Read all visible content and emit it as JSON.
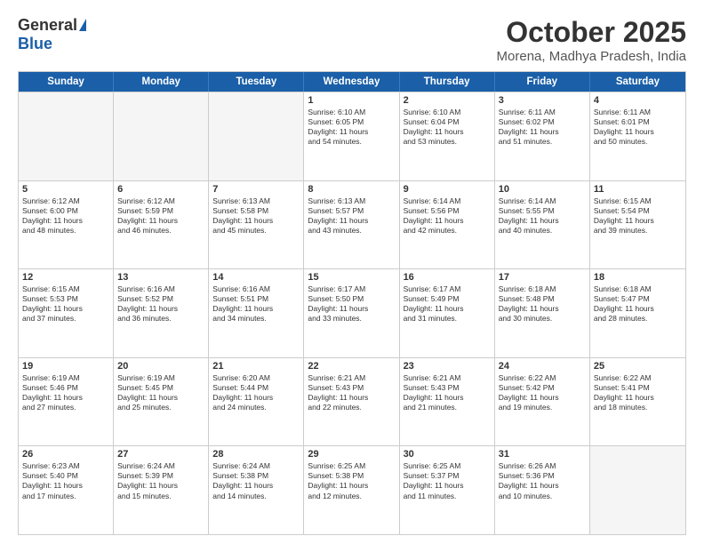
{
  "header": {
    "logo_general": "General",
    "logo_blue": "Blue",
    "main_title": "October 2025",
    "subtitle": "Morena, Madhya Pradesh, India"
  },
  "calendar": {
    "days_of_week": [
      "Sunday",
      "Monday",
      "Tuesday",
      "Wednesday",
      "Thursday",
      "Friday",
      "Saturday"
    ],
    "weeks": [
      [
        {
          "day": "",
          "sunrise": "",
          "sunset": "",
          "daylight": "",
          "empty": true
        },
        {
          "day": "",
          "sunrise": "",
          "sunset": "",
          "daylight": "",
          "empty": true
        },
        {
          "day": "",
          "sunrise": "",
          "sunset": "",
          "daylight": "",
          "empty": true
        },
        {
          "day": "1",
          "sunrise": "Sunrise: 6:10 AM",
          "sunset": "Sunset: 6:05 PM",
          "daylight": "Daylight: 11 hours and 54 minutes."
        },
        {
          "day": "2",
          "sunrise": "Sunrise: 6:10 AM",
          "sunset": "Sunset: 6:04 PM",
          "daylight": "Daylight: 11 hours and 53 minutes."
        },
        {
          "day": "3",
          "sunrise": "Sunrise: 6:11 AM",
          "sunset": "Sunset: 6:02 PM",
          "daylight": "Daylight: 11 hours and 51 minutes."
        },
        {
          "day": "4",
          "sunrise": "Sunrise: 6:11 AM",
          "sunset": "Sunset: 6:01 PM",
          "daylight": "Daylight: 11 hours and 50 minutes."
        }
      ],
      [
        {
          "day": "5",
          "sunrise": "Sunrise: 6:12 AM",
          "sunset": "Sunset: 6:00 PM",
          "daylight": "Daylight: 11 hours and 48 minutes."
        },
        {
          "day": "6",
          "sunrise": "Sunrise: 6:12 AM",
          "sunset": "Sunset: 5:59 PM",
          "daylight": "Daylight: 11 hours and 46 minutes."
        },
        {
          "day": "7",
          "sunrise": "Sunrise: 6:13 AM",
          "sunset": "Sunset: 5:58 PM",
          "daylight": "Daylight: 11 hours and 45 minutes."
        },
        {
          "day": "8",
          "sunrise": "Sunrise: 6:13 AM",
          "sunset": "Sunset: 5:57 PM",
          "daylight": "Daylight: 11 hours and 43 minutes."
        },
        {
          "day": "9",
          "sunrise": "Sunrise: 6:14 AM",
          "sunset": "Sunset: 5:56 PM",
          "daylight": "Daylight: 11 hours and 42 minutes."
        },
        {
          "day": "10",
          "sunrise": "Sunrise: 6:14 AM",
          "sunset": "Sunset: 5:55 PM",
          "daylight": "Daylight: 11 hours and 40 minutes."
        },
        {
          "day": "11",
          "sunrise": "Sunrise: 6:15 AM",
          "sunset": "Sunset: 5:54 PM",
          "daylight": "Daylight: 11 hours and 39 minutes."
        }
      ],
      [
        {
          "day": "12",
          "sunrise": "Sunrise: 6:15 AM",
          "sunset": "Sunset: 5:53 PM",
          "daylight": "Daylight: 11 hours and 37 minutes."
        },
        {
          "day": "13",
          "sunrise": "Sunrise: 6:16 AM",
          "sunset": "Sunset: 5:52 PM",
          "daylight": "Daylight: 11 hours and 36 minutes."
        },
        {
          "day": "14",
          "sunrise": "Sunrise: 6:16 AM",
          "sunset": "Sunset: 5:51 PM",
          "daylight": "Daylight: 11 hours and 34 minutes."
        },
        {
          "day": "15",
          "sunrise": "Sunrise: 6:17 AM",
          "sunset": "Sunset: 5:50 PM",
          "daylight": "Daylight: 11 hours and 33 minutes."
        },
        {
          "day": "16",
          "sunrise": "Sunrise: 6:17 AM",
          "sunset": "Sunset: 5:49 PM",
          "daylight": "Daylight: 11 hours and 31 minutes."
        },
        {
          "day": "17",
          "sunrise": "Sunrise: 6:18 AM",
          "sunset": "Sunset: 5:48 PM",
          "daylight": "Daylight: 11 hours and 30 minutes."
        },
        {
          "day": "18",
          "sunrise": "Sunrise: 6:18 AM",
          "sunset": "Sunset: 5:47 PM",
          "daylight": "Daylight: 11 hours and 28 minutes."
        }
      ],
      [
        {
          "day": "19",
          "sunrise": "Sunrise: 6:19 AM",
          "sunset": "Sunset: 5:46 PM",
          "daylight": "Daylight: 11 hours and 27 minutes."
        },
        {
          "day": "20",
          "sunrise": "Sunrise: 6:19 AM",
          "sunset": "Sunset: 5:45 PM",
          "daylight": "Daylight: 11 hours and 25 minutes."
        },
        {
          "day": "21",
          "sunrise": "Sunrise: 6:20 AM",
          "sunset": "Sunset: 5:44 PM",
          "daylight": "Daylight: 11 hours and 24 minutes."
        },
        {
          "day": "22",
          "sunrise": "Sunrise: 6:21 AM",
          "sunset": "Sunset: 5:43 PM",
          "daylight": "Daylight: 11 hours and 22 minutes."
        },
        {
          "day": "23",
          "sunrise": "Sunrise: 6:21 AM",
          "sunset": "Sunset: 5:43 PM",
          "daylight": "Daylight: 11 hours and 21 minutes."
        },
        {
          "day": "24",
          "sunrise": "Sunrise: 6:22 AM",
          "sunset": "Sunset: 5:42 PM",
          "daylight": "Daylight: 11 hours and 19 minutes."
        },
        {
          "day": "25",
          "sunrise": "Sunrise: 6:22 AM",
          "sunset": "Sunset: 5:41 PM",
          "daylight": "Daylight: 11 hours and 18 minutes."
        }
      ],
      [
        {
          "day": "26",
          "sunrise": "Sunrise: 6:23 AM",
          "sunset": "Sunset: 5:40 PM",
          "daylight": "Daylight: 11 hours and 17 minutes."
        },
        {
          "day": "27",
          "sunrise": "Sunrise: 6:24 AM",
          "sunset": "Sunset: 5:39 PM",
          "daylight": "Daylight: 11 hours and 15 minutes."
        },
        {
          "day": "28",
          "sunrise": "Sunrise: 6:24 AM",
          "sunset": "Sunset: 5:38 PM",
          "daylight": "Daylight: 11 hours and 14 minutes."
        },
        {
          "day": "29",
          "sunrise": "Sunrise: 6:25 AM",
          "sunset": "Sunset: 5:38 PM",
          "daylight": "Daylight: 11 hours and 12 minutes."
        },
        {
          "day": "30",
          "sunrise": "Sunrise: 6:25 AM",
          "sunset": "Sunset: 5:37 PM",
          "daylight": "Daylight: 11 hours and 11 minutes."
        },
        {
          "day": "31",
          "sunrise": "Sunrise: 6:26 AM",
          "sunset": "Sunset: 5:36 PM",
          "daylight": "Daylight: 11 hours and 10 minutes."
        },
        {
          "day": "",
          "sunrise": "",
          "sunset": "",
          "daylight": "",
          "empty": true
        }
      ]
    ]
  }
}
